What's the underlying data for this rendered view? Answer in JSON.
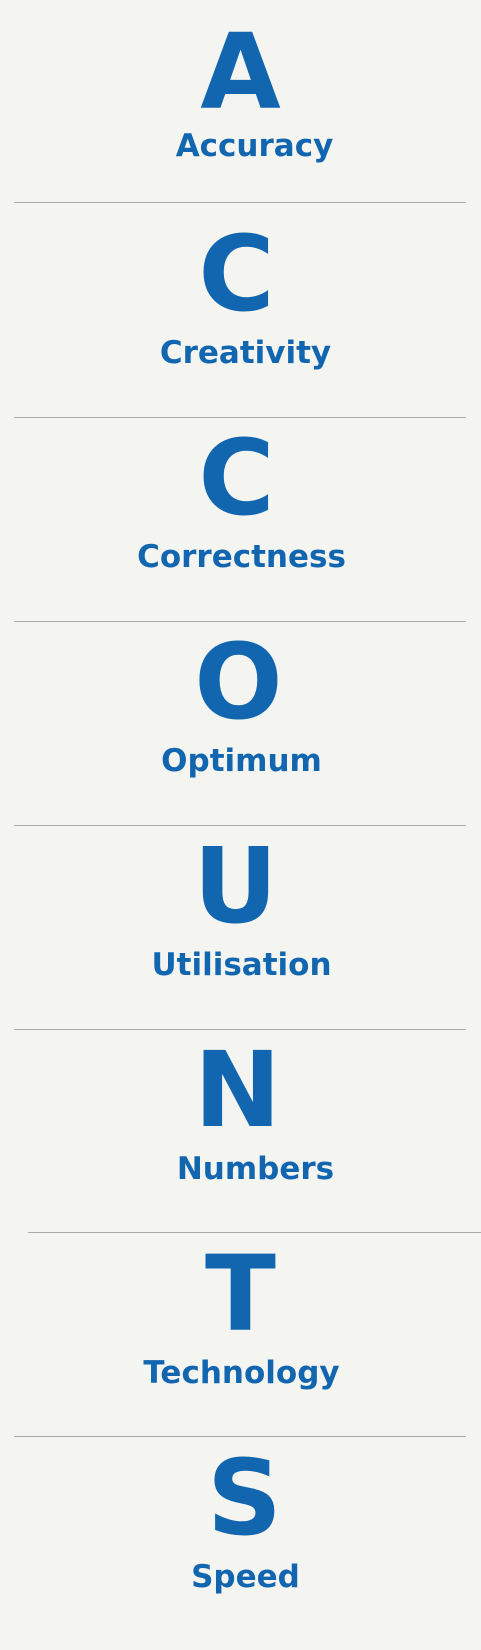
{
  "theme": {
    "background": "#f4f4f1",
    "accent": "#1266b0",
    "divider": "#a9aaa6"
  },
  "acronym": [
    {
      "letter": "A",
      "word": "Accuracy"
    },
    {
      "letter": "C",
      "word": "Creativity"
    },
    {
      "letter": "C",
      "word": "Correctness"
    },
    {
      "letter": "O",
      "word": "Optimum"
    },
    {
      "letter": "U",
      "word": "Utilisation"
    },
    {
      "letter": "N",
      "word": "Numbers"
    },
    {
      "letter": "T",
      "word": "Technology"
    },
    {
      "letter": "S",
      "word": "Speed"
    }
  ]
}
